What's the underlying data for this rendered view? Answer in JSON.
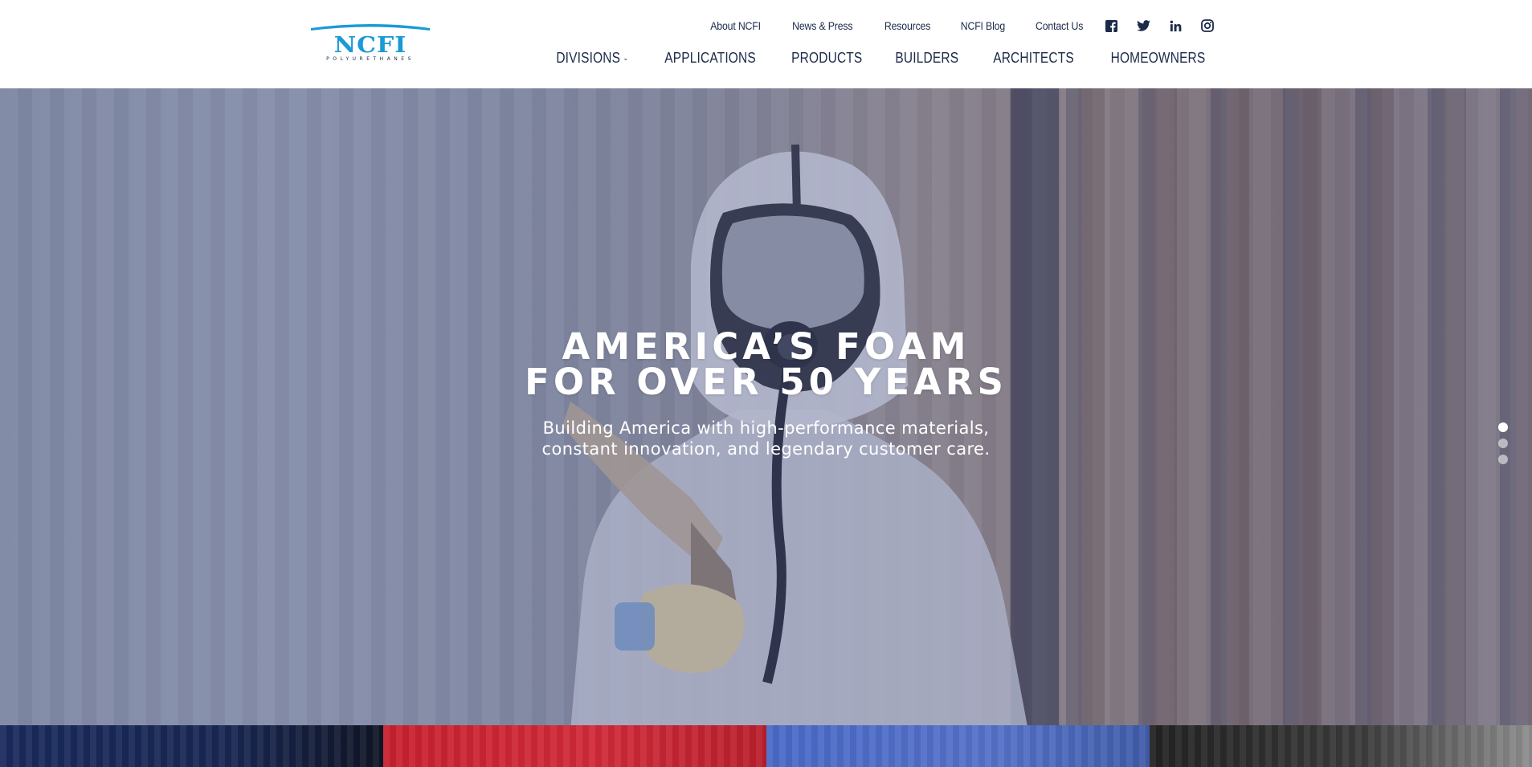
{
  "brand": {
    "logo_text": "NCFI",
    "logo_tagline": "POLYURETHANES",
    "logo_color": "#1a9ad6"
  },
  "top_nav": {
    "links": [
      "About NCFI",
      "News & Press",
      "Resources",
      "NCFI Blog",
      "Contact Us"
    ],
    "social_icons": [
      "facebook-icon",
      "twitter-icon",
      "linkedin-icon",
      "instagram-icon"
    ]
  },
  "main_nav": {
    "items": [
      "DIVISIONS",
      "APPLICATIONS",
      "PRODUCTS",
      "BUILDERS",
      "ARCHITECTS",
      "HOMEOWNERS"
    ],
    "dropdown_item": "DIVISIONS"
  },
  "hero": {
    "title_line1": "AMERICA’S FOAM",
    "title_line2": "FOR OVER 50 YEARS",
    "subtitle_line1": "Building America with high-performance materials,",
    "subtitle_line2": "constant innovation, and legendary customer care.",
    "slides_total": 3,
    "active_slide": 1
  },
  "colors": {
    "nav_text": "#1b2a49",
    "panel_navy": "#1a2a5c",
    "panel_red": "#c8202f",
    "panel_blue": "#4a69c8",
    "panel_dark": "#2a2a2a"
  }
}
